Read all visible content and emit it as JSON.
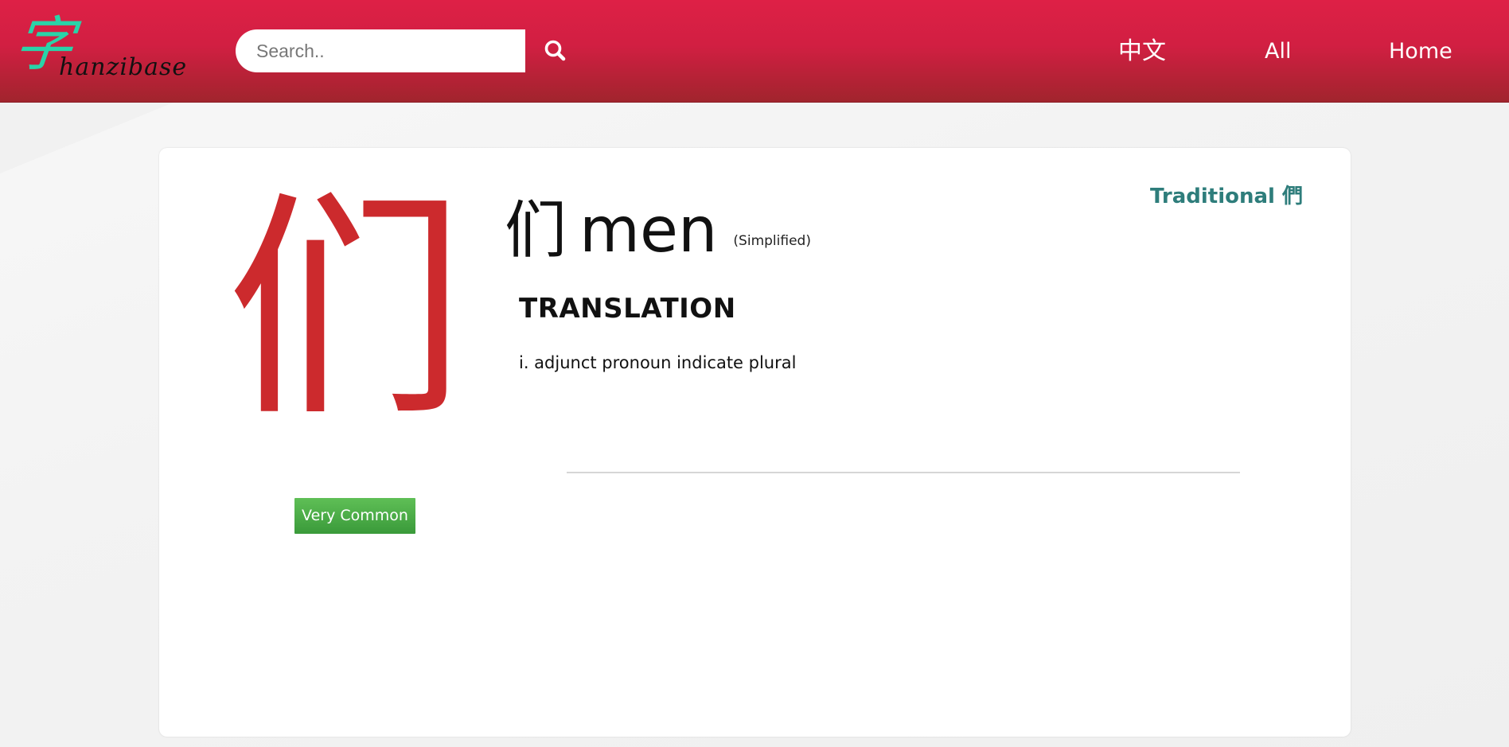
{
  "header": {
    "logo": {
      "char": "字",
      "text": "hanzibase"
    },
    "search": {
      "placeholder": "Search..",
      "value": "",
      "button_icon": "search-icon"
    },
    "nav": [
      {
        "label": "中文"
      },
      {
        "label": "All"
      },
      {
        "label": "Home"
      }
    ],
    "colors": {
      "bar_top": "#de2046",
      "bar_bottom": "#a1242d",
      "logo_char": "#2ad3a8"
    }
  },
  "entry": {
    "character": "们",
    "pinyin": "men",
    "script_note": "(Simplified)",
    "traditional_link": "Traditional 們",
    "frequency_badge": "Very Common",
    "section_title": "TRANSLATION",
    "definition": "i. adjunct pronoun indicate plural",
    "colors": {
      "character": "#cc2a2d",
      "traditional_link": "#2e7d7b",
      "badge": "#4aaa45"
    }
  }
}
